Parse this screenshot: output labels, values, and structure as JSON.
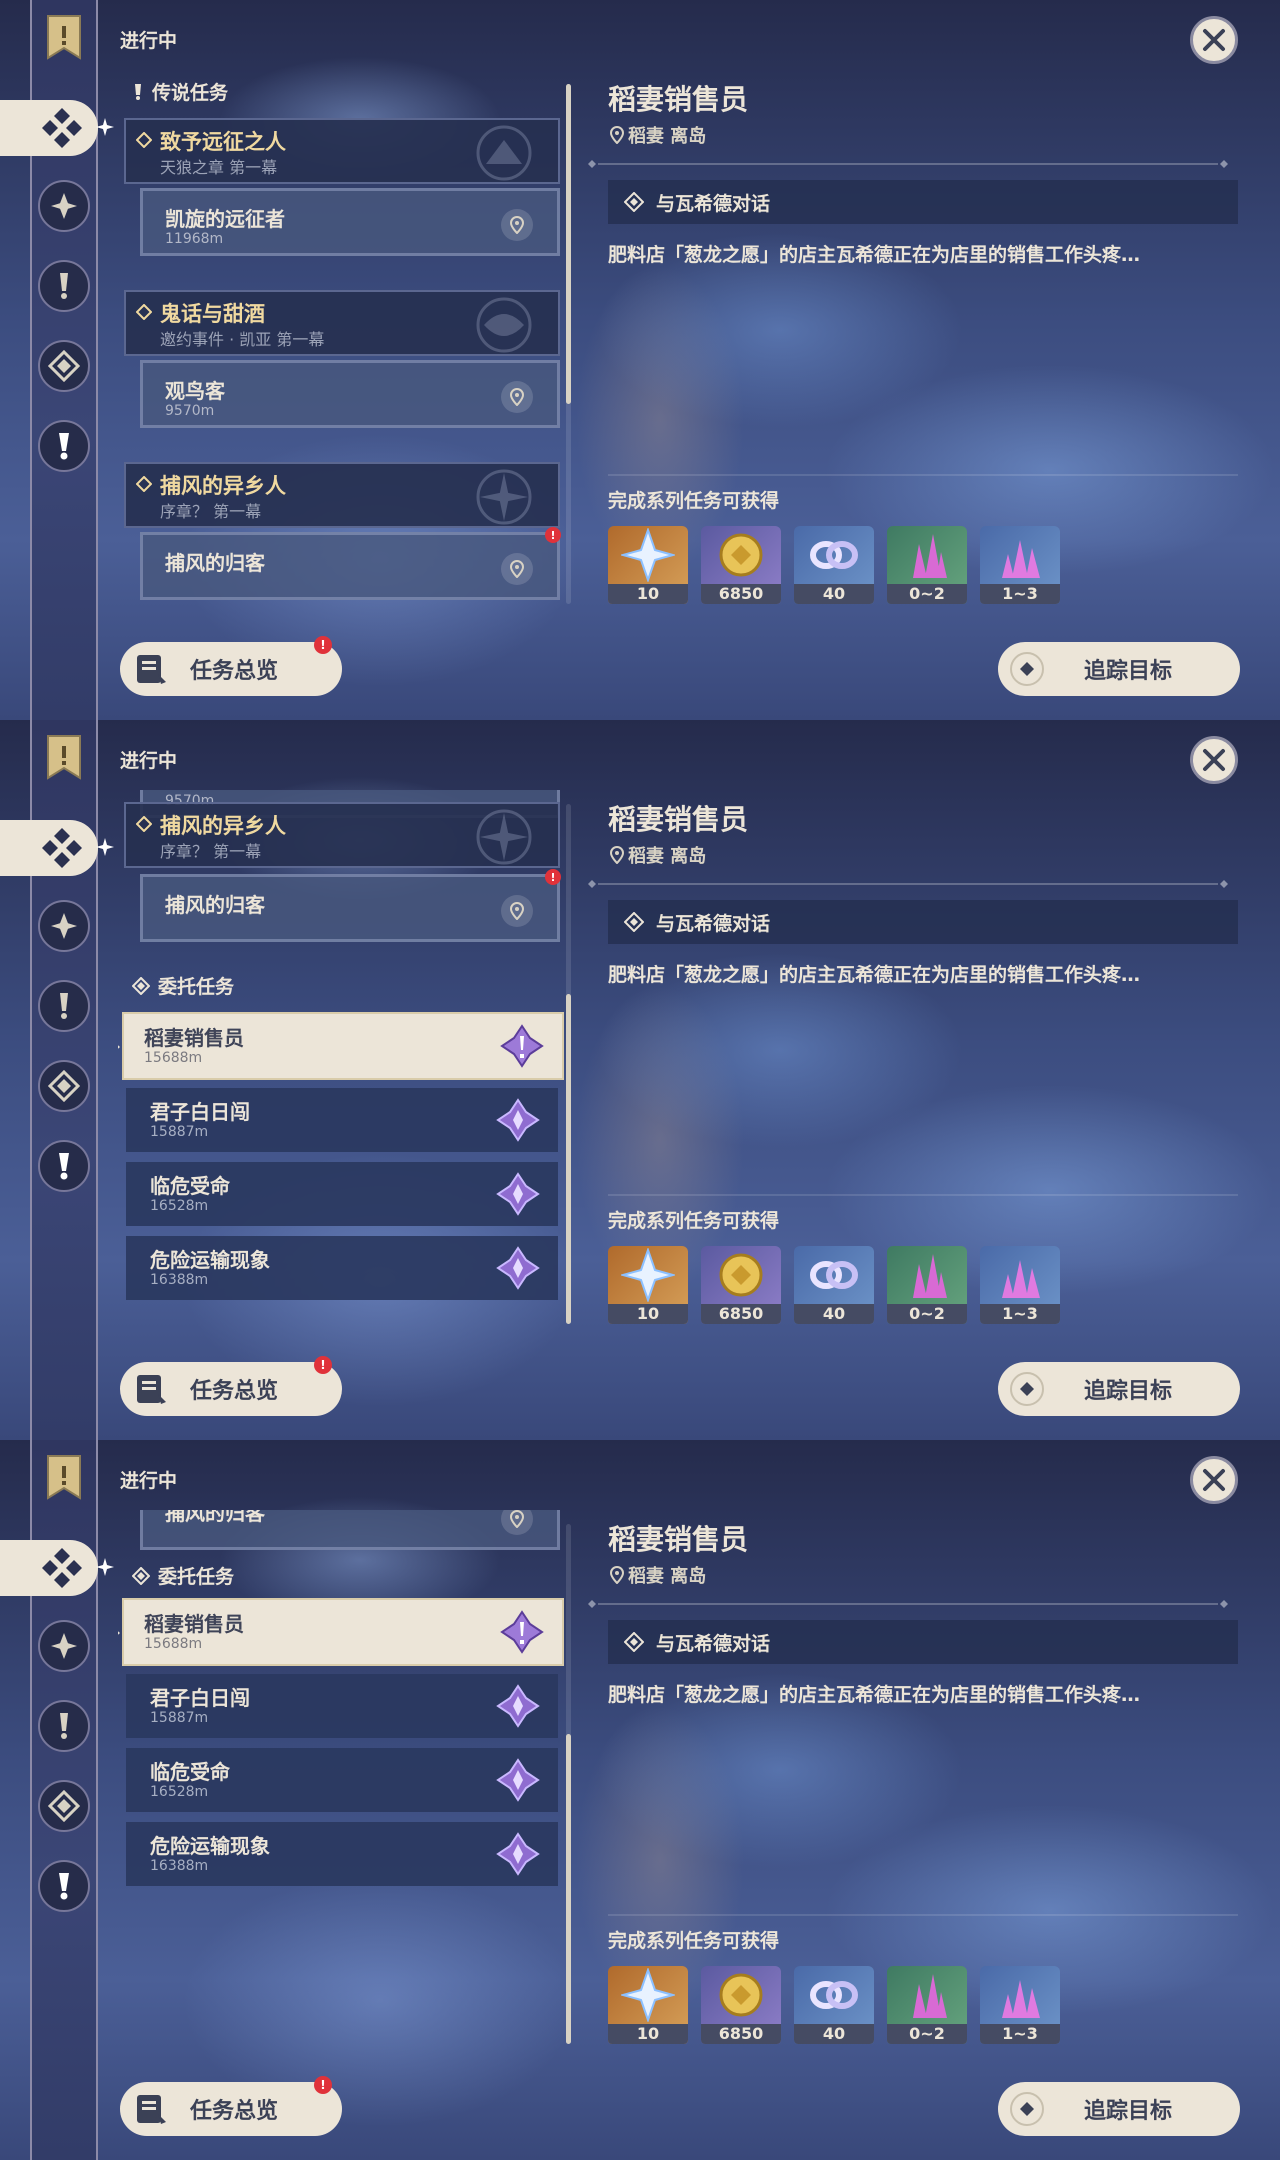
{
  "header": {
    "status": "进行中"
  },
  "categories": {
    "legend": "传说任务",
    "commission": "委托任务"
  },
  "chapters": [
    {
      "title": "致予远征之人",
      "subtitle": "天狼之章 第一幕"
    },
    {
      "title": "鬼话与甜酒",
      "subtitle": "邀约事件 · 凯亚 第一幕"
    },
    {
      "title": "捕风的异乡人",
      "subtitle": "序章？ 第一幕"
    }
  ],
  "legend_quests": [
    {
      "title": "凯旋的远征者",
      "distance": "11968m",
      "badge": ""
    },
    {
      "title": "观鸟客",
      "distance": "9570m",
      "badge": ""
    },
    {
      "title": "捕风的归客",
      "distance": "",
      "badge": "!"
    }
  ],
  "commissions": [
    {
      "title": "稻妻销售员",
      "distance": "15688m"
    },
    {
      "title": "君子白日闯",
      "distance": "15887m"
    },
    {
      "title": "临危受命",
      "distance": "16528m"
    },
    {
      "title": "危险运输现象",
      "distance": "16388m"
    }
  ],
  "detail": {
    "title": "稻妻销售员",
    "location": "稻妻 离岛",
    "objective": "与瓦希德对话",
    "description": "肥料店「葱龙之愿」的店主瓦希德正在为店里的销售工作头疼…",
    "rewards_label": "完成系列任务可获得",
    "rewards": [
      {
        "icon": "primogem-icon",
        "count": "10"
      },
      {
        "icon": "mora-icon",
        "count": "6850"
      },
      {
        "icon": "friendship-icon",
        "count": "40"
      },
      {
        "icon": "crystal-green-icon",
        "count": "0~2"
      },
      {
        "icon": "crystal-blue-icon",
        "count": "1~3"
      }
    ]
  },
  "buttons": {
    "overview": "任务总览",
    "overview_badge": "!",
    "track": "追踪目标"
  },
  "colors": {
    "accent": "#ece5d8",
    "gold": "#f0d9a0",
    "badge": "#e0323a"
  }
}
